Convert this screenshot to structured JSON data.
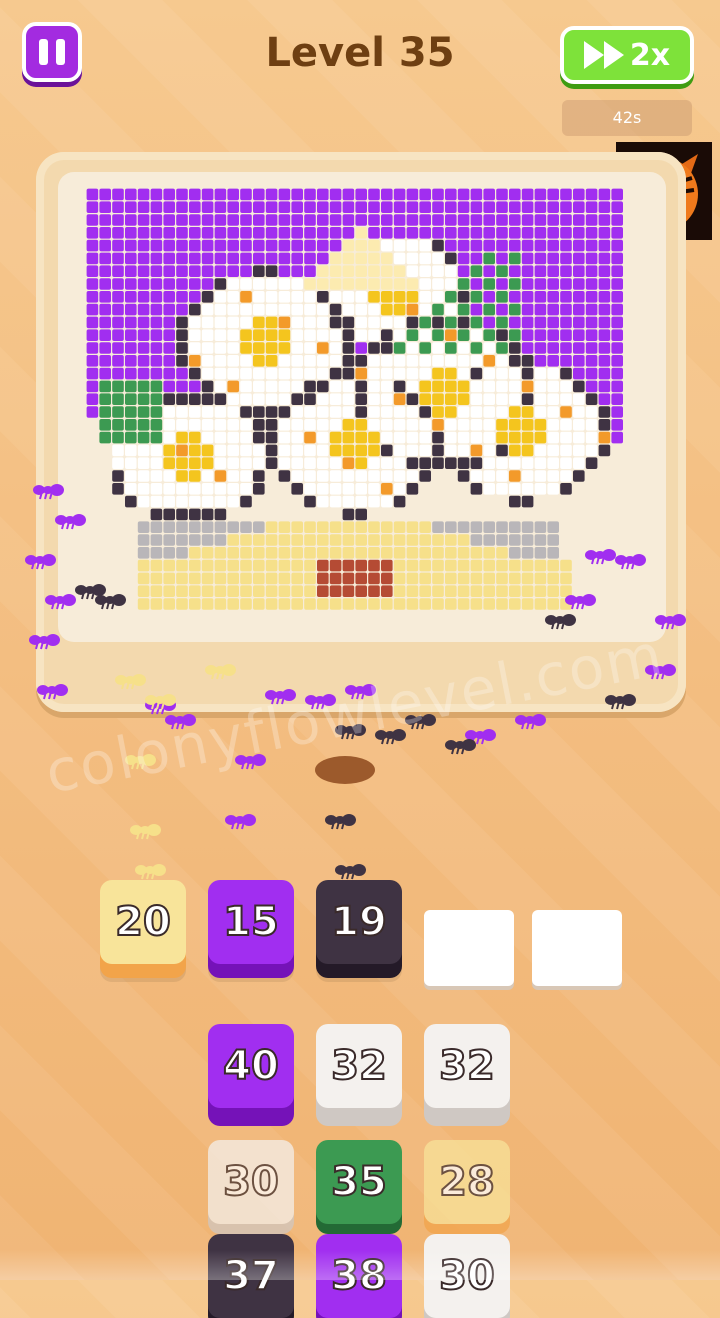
{
  "header": {
    "level_label": "Level 35",
    "speed_label": "2x",
    "timer": "42s"
  },
  "colors": {
    "purple": "#a12ef0",
    "yellow": "#f6e08a",
    "dark": "#3f3343",
    "white": "#ffffff",
    "green": "#3c9a52",
    "gray": "#b9b6b9",
    "orange": "#f39a2a",
    "gold": "#f4c51e",
    "red": "#b54b34",
    "cream": "#fcebb0"
  },
  "queue": [
    {
      "value": "20",
      "color": "yellow"
    },
    {
      "value": "15",
      "color": "purple"
    },
    {
      "value": "19",
      "color": "dark"
    },
    {
      "value": "",
      "color": "empty"
    },
    {
      "value": "",
      "color": "empty"
    }
  ],
  "stacks": [
    {
      "value": "40",
      "color": "purple"
    },
    {
      "value": "32",
      "color": "white"
    },
    {
      "value": "32",
      "color": "white"
    },
    {
      "value": "30",
      "color": "white"
    },
    {
      "value": "35",
      "color": "green"
    },
    {
      "value": "28",
      "color": "yellow"
    },
    {
      "value": "37",
      "color": "dark"
    },
    {
      "value": "38",
      "color": "purple"
    },
    {
      "value": "30",
      "color": "white"
    }
  ],
  "watermark": "colonyflowlevel.com",
  "icons": [
    "pause-icon",
    "fast-forward-icon",
    "tiger-logo-icon"
  ]
}
